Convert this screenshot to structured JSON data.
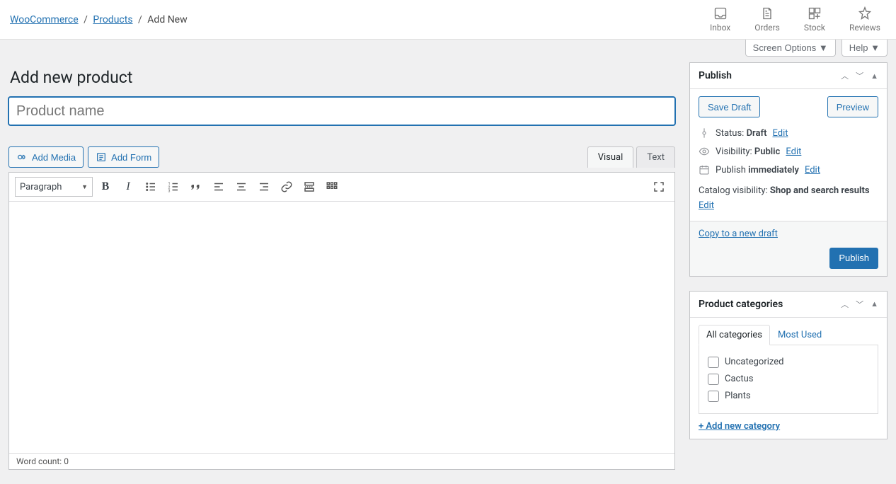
{
  "breadcrumb": {
    "items": [
      {
        "label": "WooCommerce",
        "link": true
      },
      {
        "label": "Products",
        "link": true
      },
      {
        "label": "Add New",
        "link": false
      }
    ]
  },
  "activity": {
    "inbox": "Inbox",
    "orders": "Orders",
    "stock": "Stock",
    "reviews": "Reviews"
  },
  "screen_meta": {
    "screen_options": "Screen Options",
    "help": "Help"
  },
  "page": {
    "title": "Add new product",
    "product_name_placeholder": "Product name"
  },
  "editor": {
    "add_media": "Add Media",
    "add_form": "Add Form",
    "tab_visual": "Visual",
    "tab_text": "Text",
    "format_label": "Paragraph",
    "word_count_label": "Word count:",
    "word_count_value": "0"
  },
  "publish_box": {
    "title": "Publish",
    "save_draft": "Save Draft",
    "preview": "Preview",
    "status_label": "Status:",
    "status_value": "Draft",
    "edit": "Edit",
    "visibility_label": "Visibility:",
    "visibility_value": "Public",
    "publish_label": "Publish",
    "publish_value": "immediately",
    "catalog_label": "Catalog visibility:",
    "catalog_value": "Shop and search results",
    "copy_link": "Copy to a new draft",
    "publish_btn": "Publish"
  },
  "categories_box": {
    "title": "Product categories",
    "tab_all": "All categories",
    "tab_most": "Most Used",
    "items": [
      "Uncategorized",
      "Cactus",
      "Plants"
    ],
    "add_new": "+ Add new category"
  }
}
